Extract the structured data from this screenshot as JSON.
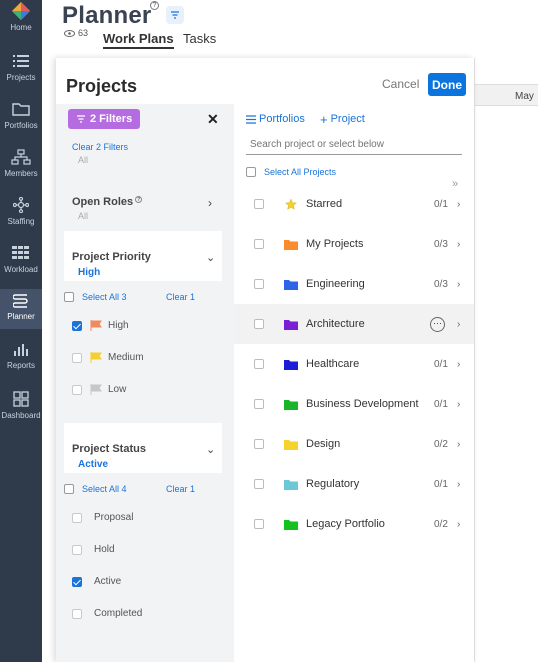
{
  "nav": {
    "items": [
      {
        "label": "Home",
        "icon": "app-logo-icon",
        "active": false
      },
      {
        "label": "Projects",
        "icon": "projects-list-icon",
        "active": false
      },
      {
        "label": "Portfolios",
        "icon": "folder-icon",
        "active": false
      },
      {
        "label": "Members",
        "icon": "members-org-icon",
        "active": false
      },
      {
        "label": "Staffing",
        "icon": "staffing-icon",
        "active": false
      },
      {
        "label": "Workload",
        "icon": "workload-grid-icon",
        "active": false
      },
      {
        "label": "Planner",
        "icon": "planner-icon",
        "active": true
      },
      {
        "label": "Reports",
        "icon": "reports-chart-icon",
        "active": false
      },
      {
        "label": "Dashboard",
        "icon": "dashboard-icon",
        "active": false
      }
    ]
  },
  "header": {
    "title": "Planner",
    "view_count": "63",
    "tabs": [
      {
        "label": "Work Plans",
        "active": true
      },
      {
        "label": "Tasks",
        "active": false
      }
    ]
  },
  "board": {
    "month": "May"
  },
  "panel": {
    "title": "Projects",
    "cancel_label": "Cancel",
    "done_label": "Done",
    "filters": {
      "badge_label": "2 Filters",
      "clear_label": "Clear 2 Filters",
      "clear_sub": "All",
      "open_roles": {
        "title": "Open Roles",
        "sub": "All"
      },
      "priority": {
        "title": "Project Priority",
        "selected": "High",
        "select_all": "Select All 3",
        "clear": "Clear 1",
        "options": [
          {
            "label": "High",
            "checked": true,
            "color": "#f08a5d"
          },
          {
            "label": "Medium",
            "checked": false,
            "color": "#f5cf2f"
          },
          {
            "label": "Low",
            "checked": false,
            "color": "#c7c7c7"
          }
        ]
      },
      "status": {
        "title": "Project Status",
        "selected": "Active",
        "select_all": "Select All 4",
        "clear": "Clear 1",
        "options": [
          {
            "label": "Proposal",
            "checked": false
          },
          {
            "label": "Hold",
            "checked": false
          },
          {
            "label": "Active",
            "checked": true
          },
          {
            "label": "Completed",
            "checked": false
          }
        ]
      }
    },
    "projects": {
      "portfolios_link": "Portfolios",
      "add_project_link": "Project",
      "search_placeholder": "Search project or select below",
      "select_all": "Select All Projects",
      "rows": [
        {
          "name": "Starred",
          "count": "0/1",
          "color": "#f5cf2f",
          "icon": "star-icon"
        },
        {
          "name": "My Projects",
          "count": "0/3",
          "color": "#fb8c2b",
          "icon": "folder-icon"
        },
        {
          "name": "Engineering",
          "count": "0/3",
          "color": "#2f63e8",
          "icon": "folder-icon"
        },
        {
          "name": "Architecture",
          "count": "",
          "color": "#7b1fd6",
          "icon": "folder-icon"
        },
        {
          "name": "Healthcare",
          "count": "0/1",
          "color": "#1a1fd6",
          "icon": "folder-icon"
        },
        {
          "name": "Business Development",
          "count": "0/1",
          "color": "#18b52b",
          "icon": "folder-icon"
        },
        {
          "name": "Design",
          "count": "0/2",
          "color": "#f5d32a",
          "icon": "folder-icon"
        },
        {
          "name": "Regulatory",
          "count": "0/1",
          "color": "#6bc9d6",
          "icon": "folder-icon"
        },
        {
          "name": "Legacy Portfolio",
          "count": "0/2",
          "color": "#13c21e",
          "icon": "folder-icon"
        }
      ]
    }
  }
}
